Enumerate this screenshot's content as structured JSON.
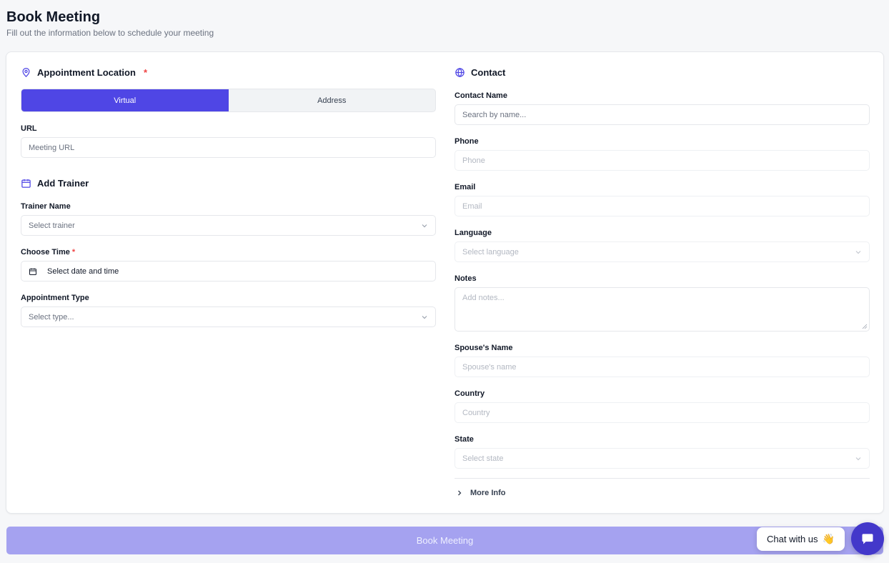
{
  "header": {
    "title": "Book Meeting",
    "subtitle": "Fill out the information below to schedule your meeting"
  },
  "colors": {
    "accent": "#4f46e5",
    "button_disabled": "#a5a2f0",
    "required": "#ef4444"
  },
  "location": {
    "title": "Appointment Location",
    "required_mark": "*",
    "options": [
      "Virtual",
      "Address"
    ],
    "selected": "Virtual",
    "url_label": "URL",
    "url_placeholder": "Meeting URL"
  },
  "trainer": {
    "title": "Add Trainer",
    "trainer_name_label": "Trainer Name",
    "trainer_name_placeholder": "Select trainer",
    "time_label": "Choose Time",
    "time_required_mark": "*",
    "time_value": "Select date and time",
    "type_label": "Appointment Type",
    "type_placeholder": "Select type..."
  },
  "contact": {
    "title": "Contact",
    "name_label": "Contact Name",
    "name_placeholder": "Search by name...",
    "phone_label": "Phone",
    "phone_placeholder": "Phone",
    "email_label": "Email",
    "email_placeholder": "Email",
    "language_label": "Language",
    "language_placeholder": "Select language",
    "notes_label": "Notes",
    "notes_placeholder": "Add notes...",
    "spouse_label": "Spouse's Name",
    "spouse_placeholder": "Spouse's name",
    "country_label": "Country",
    "country_placeholder": "Country",
    "state_label": "State",
    "state_placeholder": "Select state",
    "more_info": "More Info"
  },
  "footer": {
    "book_button": "Book Meeting",
    "chat_label": "Chat with us",
    "chat_emoji": "👋"
  }
}
